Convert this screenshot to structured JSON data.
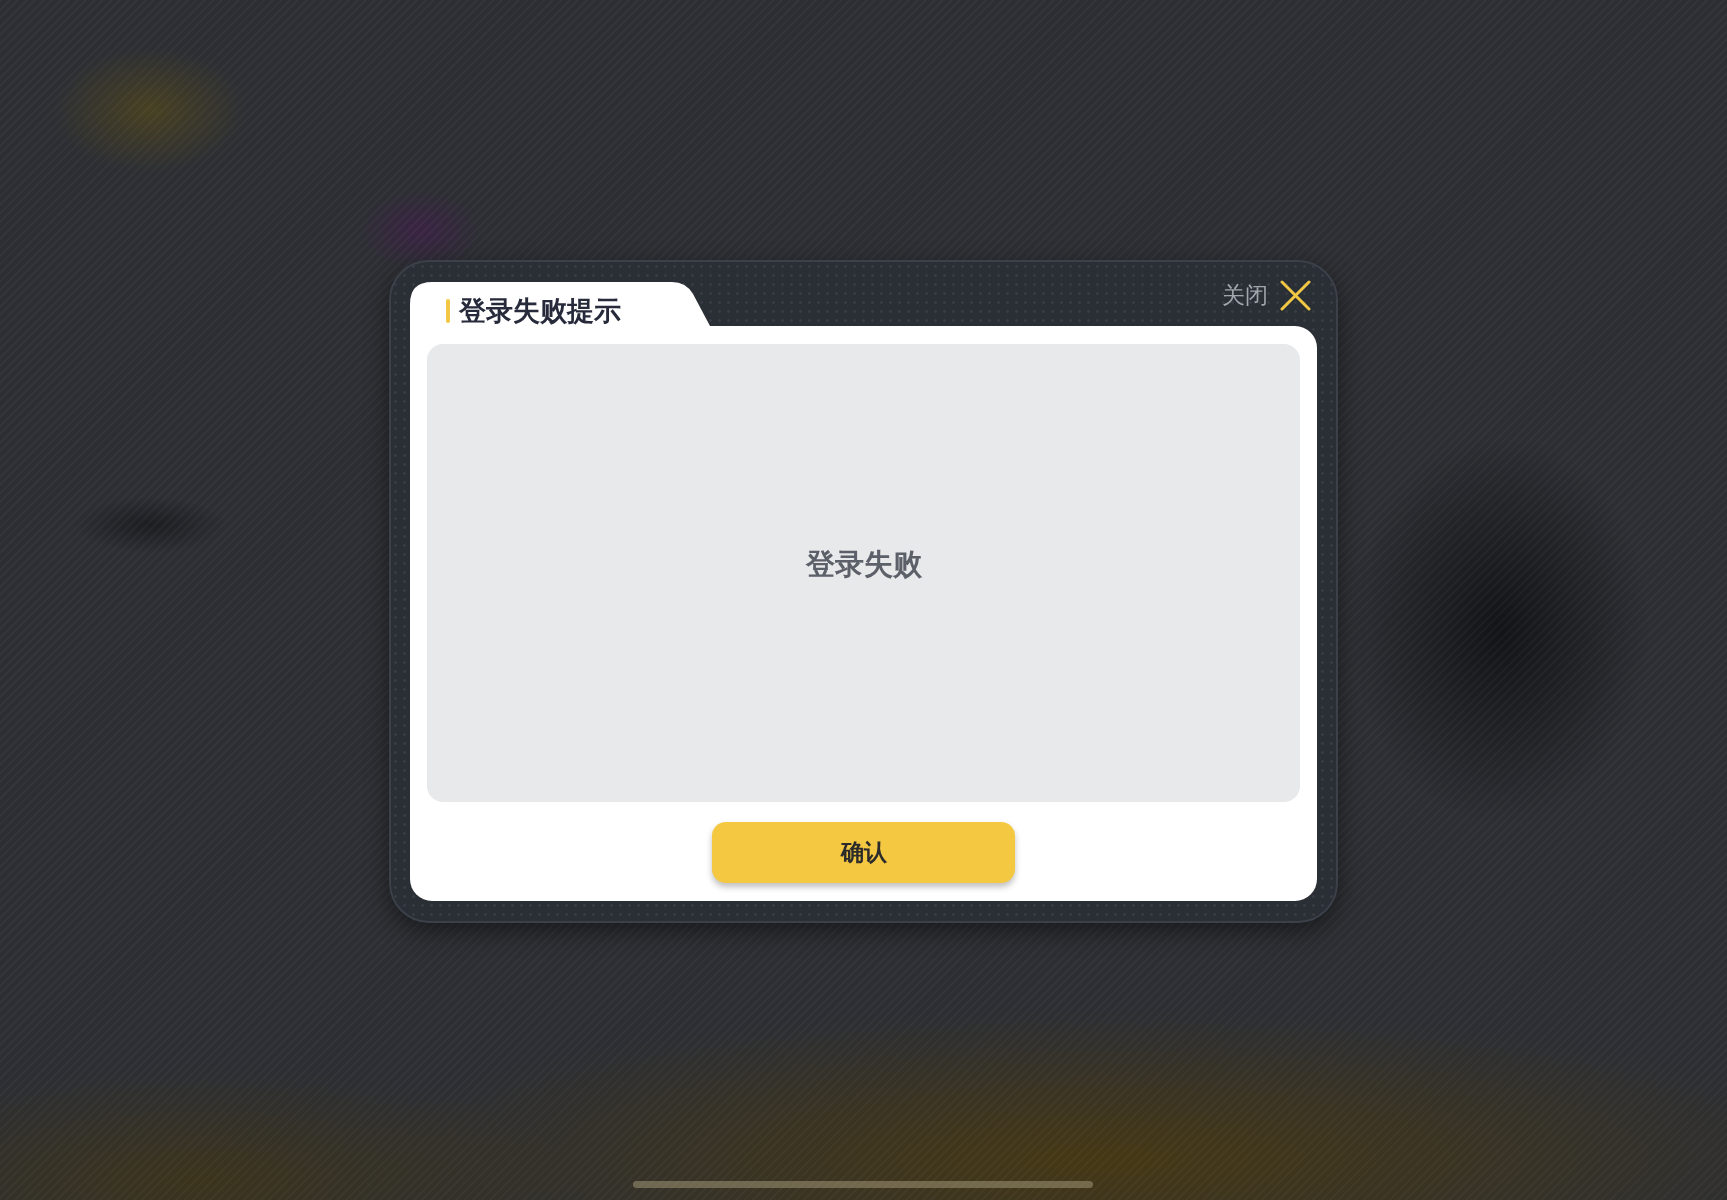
{
  "dialog": {
    "title": "登录失败提示",
    "close_label": "关闭",
    "message": "登录失败",
    "confirm_button": "确认"
  }
}
